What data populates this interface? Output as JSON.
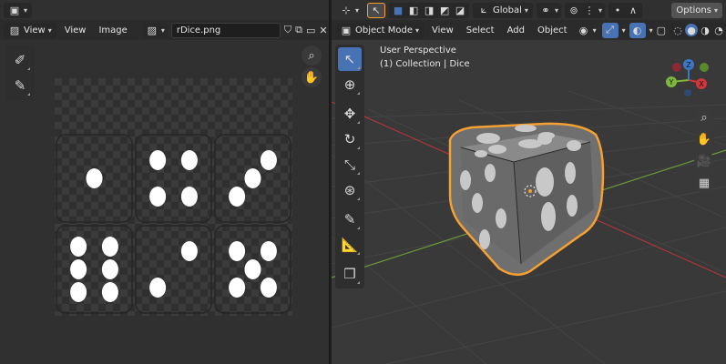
{
  "image_editor": {
    "menu": [
      "View",
      "View",
      "Image"
    ],
    "filename": "rDice.png",
    "texture_faces": [
      {
        "label": "one",
        "pips": 1
      },
      {
        "label": "four",
        "pips": 4
      },
      {
        "label": "three",
        "pips": 3
      },
      {
        "label": "six",
        "pips": 6
      },
      {
        "label": "two",
        "pips": 2
      },
      {
        "label": "five",
        "pips": 5
      }
    ]
  },
  "viewport": {
    "transform_orientation": "Global",
    "options_label": "Options",
    "mode": "Object Mode",
    "menu": [
      "View",
      "Select",
      "Add",
      "Object"
    ],
    "overlay_title": "User Perspective",
    "overlay_subtitle": "(1) Collection | Dice",
    "gizmo_axes": {
      "x": "X",
      "y": "Y",
      "z": "Z"
    }
  },
  "colors": {
    "accent": "#4772b3",
    "selection_outline": "#f5a033",
    "x_axis": "#d0363c",
    "y_axis": "#7db83a",
    "z_axis": "#3c78c8"
  },
  "icons": [
    "editor-type-icon",
    "image-icon",
    "shield-icon",
    "duplicate-icon",
    "folder-icon",
    "close-icon",
    "pin-icon",
    "sample-tool-icon",
    "annotate-tool-icon",
    "zoom-icon",
    "hand-icon",
    "select-box-icon",
    "cursor-icon",
    "move-icon",
    "rotate-icon",
    "scale-icon",
    "transform-icon",
    "measure-icon",
    "add-cube-icon",
    "camera-icon",
    "grid-icon"
  ]
}
